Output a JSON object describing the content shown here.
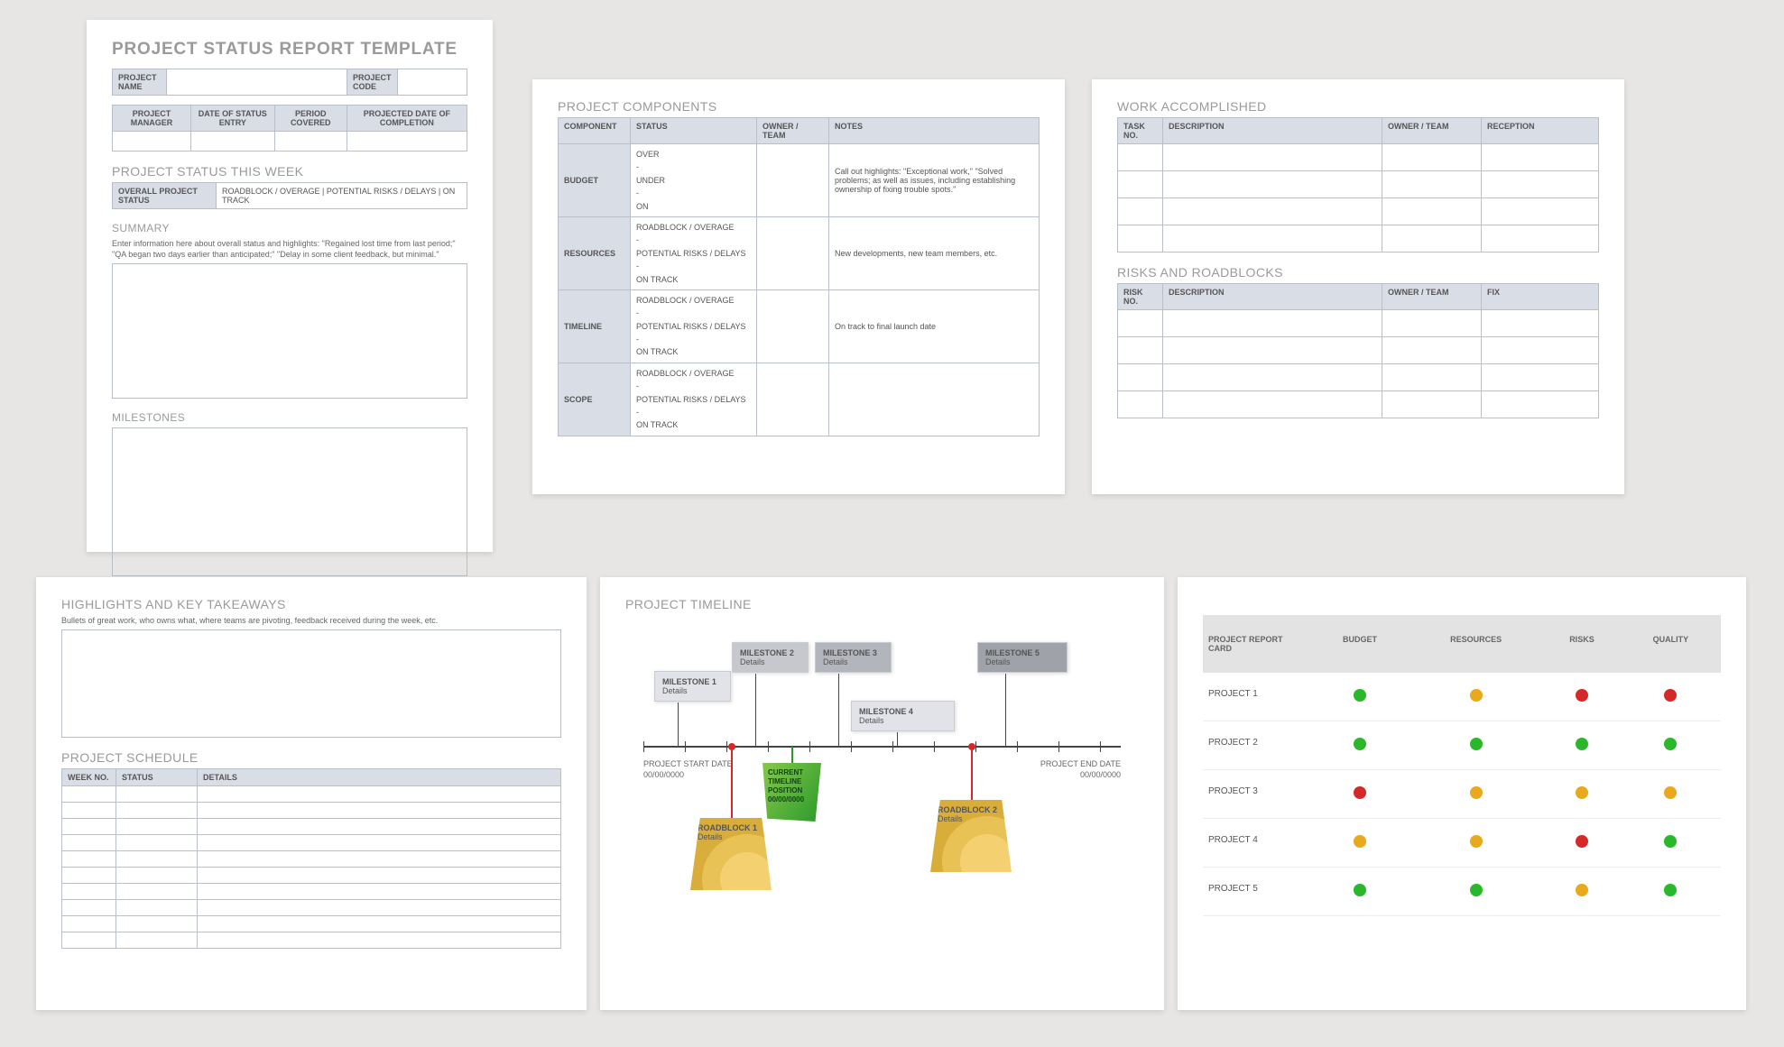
{
  "p1": {
    "title": "PROJECT STATUS REPORT TEMPLATE",
    "name_label": "PROJECT NAME",
    "code_label": "PROJECT CODE",
    "cols": [
      "PROJECT MANAGER",
      "DATE OF STATUS ENTRY",
      "PERIOD COVERED",
      "PROJECTED DATE OF COMPLETION"
    ],
    "statusweek_title": "PROJECT STATUS THIS WEEK",
    "status_label": "OVERALL PROJECT STATUS",
    "status_opts": "ROADBLOCK / OVERAGE   |   POTENTIAL RISKS / DELAYS   |   ON TRACK",
    "summary_title": "SUMMARY",
    "summary_hint": "Enter information here about overall status and highlights: \"Regained lost time from last period;\" \"QA began two days earlier than anticipated;\" \"Delay in some client feedback, but minimal.\"",
    "milestones_title": "MILESTONES"
  },
  "p2": {
    "title": "PROJECT COMPONENTS",
    "headers": [
      "COMPONENT",
      "STATUS",
      "OWNER / TEAM",
      "NOTES"
    ],
    "rows": [
      {
        "c": "BUDGET",
        "s": [
          "OVER",
          "-",
          "UNDER",
          "-",
          "ON"
        ],
        "n": "Call out highlights: \"Exceptional work,\" \"Solved problems; as well as issues, including establishing ownership of fixing trouble spots.\""
      },
      {
        "c": "RESOURCES",
        "s": [
          "ROADBLOCK / OVERAGE",
          "-",
          "POTENTIAL RISKS / DELAYS",
          "-",
          "ON TRACK"
        ],
        "n": "New developments, new team members, etc."
      },
      {
        "c": "TIMELINE",
        "s": [
          "ROADBLOCK / OVERAGE",
          "-",
          "POTENTIAL RISKS / DELAYS",
          "-",
          "ON TRACK"
        ],
        "n": "On track to final launch date"
      },
      {
        "c": "SCOPE",
        "s": [
          "ROADBLOCK / OVERAGE",
          "-",
          "POTENTIAL RISKS / DELAYS",
          "-",
          "ON TRACK"
        ],
        "n": ""
      }
    ]
  },
  "p3": {
    "work_title": "WORK ACCOMPLISHED",
    "work_headers": [
      "TASK NO.",
      "DESCRIPTION",
      "OWNER / TEAM",
      "RECEPTION"
    ],
    "risk_title": "RISKS AND ROADBLOCKS",
    "risk_headers": [
      "RISK NO.",
      "DESCRIPTION",
      "OWNER / TEAM",
      "FIX"
    ]
  },
  "p4": {
    "highlights_title": "HIGHLIGHTS AND KEY TAKEAWAYS",
    "highlights_hint": "Bullets of great work, who owns what, where teams are pivoting, feedback received during the week, etc.",
    "schedule_title": "PROJECT SCHEDULE",
    "schedule_headers": [
      "WEEK NO.",
      "STATUS",
      "DETAILS"
    ]
  },
  "p5": {
    "title": "PROJECT TIMELINE",
    "start_label": "PROJECT START DATE",
    "start_date": "00/00/0000",
    "end_label": "PROJECT END DATE",
    "end_date": "00/00/0000",
    "miles": [
      {
        "t": "MILESTONE 1",
        "d": "Details"
      },
      {
        "t": "MILESTONE 2",
        "d": "Details"
      },
      {
        "t": "MILESTONE 3",
        "d": "Details"
      },
      {
        "t": "MILESTONE 4",
        "d": "Details"
      },
      {
        "t": "MILESTONE 5",
        "d": "Details"
      }
    ],
    "current": "CURRENT TIMELINE POSITION 00/00/0000",
    "rb1": {
      "t": "ROADBLOCK 1",
      "d": "Details"
    },
    "rb2": {
      "t": "ROADBLOCK 2",
      "d": "Details"
    }
  },
  "p6": {
    "header": [
      "PROJECT REPORT CARD",
      "BUDGET",
      "RESOURCES",
      "RISKS",
      "QUALITY"
    ],
    "rows": [
      {
        "name": "PROJECT 1",
        "dots": [
          "green",
          "yellow",
          "red",
          "red"
        ]
      },
      {
        "name": "PROJECT 2",
        "dots": [
          "green",
          "green",
          "green",
          "green"
        ]
      },
      {
        "name": "PROJECT 3",
        "dots": [
          "red",
          "yellow",
          "yellow",
          "yellow"
        ]
      },
      {
        "name": "PROJECT 4",
        "dots": [
          "yellow",
          "yellow",
          "red",
          "green"
        ]
      },
      {
        "name": "PROJECT 5",
        "dots": [
          "green",
          "green",
          "yellow",
          "green"
        ]
      }
    ]
  }
}
